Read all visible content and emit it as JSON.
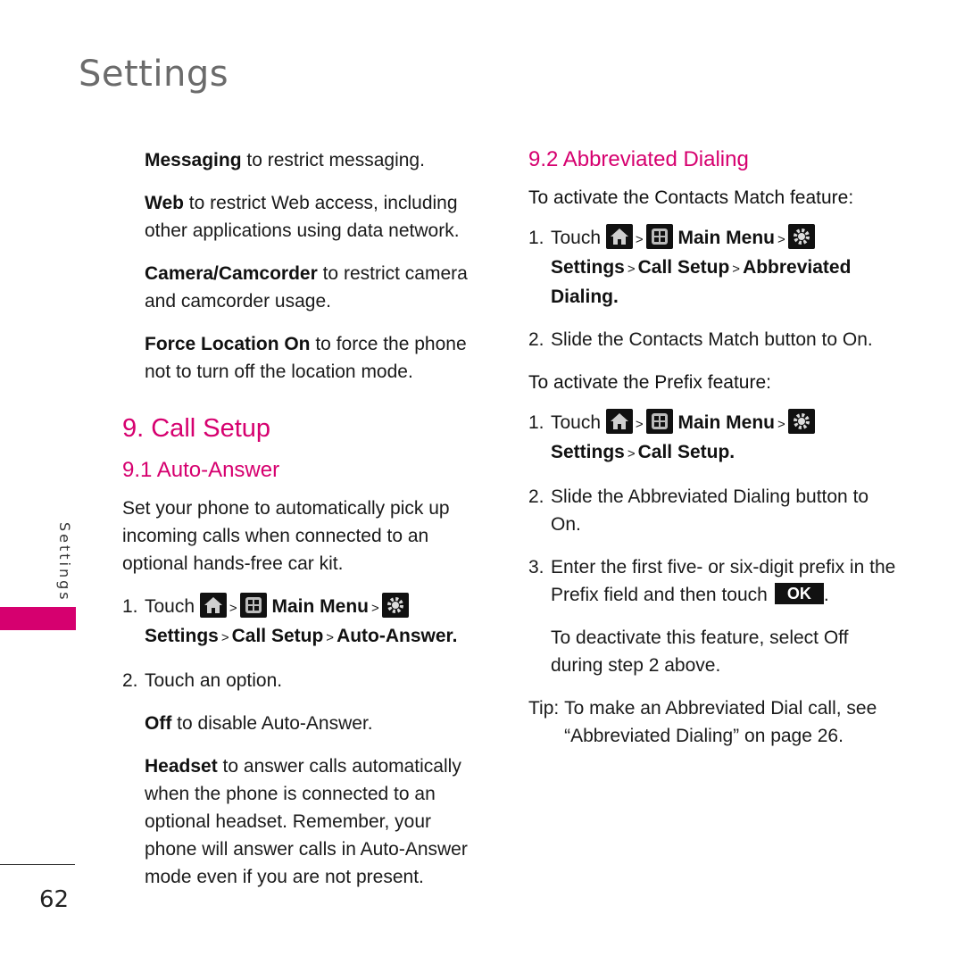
{
  "header": {
    "title": "Settings"
  },
  "side_tab": {
    "label": "Settings",
    "accent_color": "#d6006f"
  },
  "footer": {
    "page_number": "62"
  },
  "left": {
    "options_intro": [
      {
        "term": "Messaging",
        "text": " to restrict messaging."
      },
      {
        "term": "Web",
        "text": " to restrict Web access, including other applications using data network."
      },
      {
        "term": "Camera/Camcorder",
        "text": " to restrict camera and camcorder usage."
      },
      {
        "term": "Force Location On",
        "text": " to force the phone not to turn off the location mode."
      }
    ],
    "section_title": "9. Call Setup",
    "subsection_title": "9.1 Auto-Answer",
    "description": "Set your phone to automatically pick up incoming calls when connected to an optional hands-free car kit.",
    "steps": [
      {
        "num": "1.",
        "touch": "Touch",
        "main_menu": "Main Menu",
        "path": [
          "Settings",
          "Call Setup",
          "Auto-Answer."
        ]
      },
      {
        "num": "2.",
        "text": "Touch an option."
      }
    ],
    "options": [
      {
        "term": "Off",
        "text": " to disable Auto-Answer."
      },
      {
        "term": "Headset",
        "text": " to answer calls automatically when the phone is connected to an optional headset. Remember, your phone will answer calls in Auto-Answer mode even if you are not present."
      }
    ]
  },
  "right": {
    "subsection_title": "9.2 Abbreviated Dialing",
    "contacts_match": {
      "heading": "To activate the Contacts Match feature:",
      "step1": {
        "num": "1.",
        "touch": "Touch",
        "main_menu": "Main Menu",
        "path": [
          "Settings",
          "Call Setup",
          "Abbreviated Dialing."
        ]
      },
      "step2": {
        "num": "2.",
        "text": "Slide the Contacts Match button to On."
      }
    },
    "prefix": {
      "heading": "To activate the Prefix feature:",
      "step1": {
        "num": "1.",
        "touch": "Touch",
        "main_menu": "Main Menu",
        "path": [
          "Settings",
          "Call Setup."
        ]
      },
      "step2": {
        "num": "2.",
        "text": "Slide the Abbreviated Dialing button to On."
      },
      "step3": {
        "num": "3.",
        "text": "Enter the first five- or six-digit prefix in the Prefix field and then touch",
        "button": "OK",
        "after": "."
      },
      "deactivate": "To deactivate this feature, select Off during step 2 above."
    },
    "tip": {
      "label": "Tip:",
      "text": "To make an Abbreviated Dial call, see “Abbreviated Dialing” on page 26."
    }
  },
  "icons": {
    "home": "home-icon",
    "main_menu": "main-menu-icon",
    "settings": "gear-icon",
    "separator": ">"
  }
}
